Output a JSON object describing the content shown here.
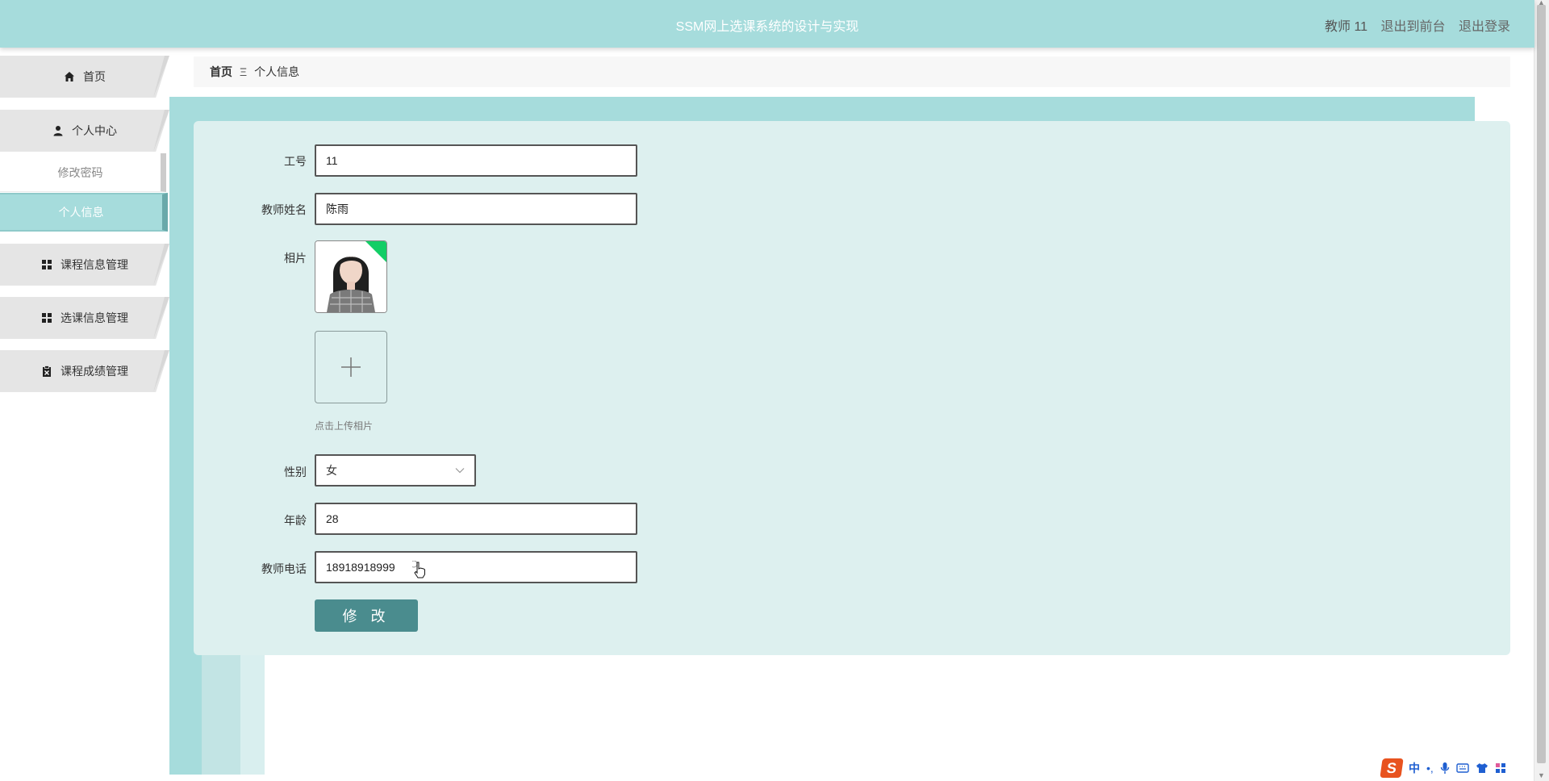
{
  "header": {
    "title": "SSM网上选课系统的设计与实现",
    "user": "教师 11",
    "back_front": "退出到前台",
    "logout": "退出登录"
  },
  "sidebar": {
    "home": "首页",
    "personal_center": "个人中心",
    "change_password": "修改密码",
    "personal_info": "个人信息",
    "course_mgmt": "课程信息管理",
    "selection_mgmt": "选课信息管理",
    "grade_mgmt": "课程成绩管理"
  },
  "breadcrumb": {
    "home": "首页",
    "separator": "Ξ",
    "current": "个人信息"
  },
  "form": {
    "id_label": "工号",
    "id_value": "11",
    "name_label": "教师姓名",
    "name_value": "陈雨",
    "photo_label": "相片",
    "upload_hint": "点击上传相片",
    "gender_label": "性别",
    "gender_value": "女",
    "age_label": "年龄",
    "age_value": "28",
    "phone_label": "教师电话",
    "phone_value": "18918918999",
    "submit_label": "修 改"
  },
  "ime": {
    "logo": "S",
    "mode": "中",
    "punct": "•,"
  },
  "colors": {
    "header_bg": "#a6dcdc",
    "form_bg": "#ddf0ef",
    "button_bg": "#4a8c8e",
    "upload_success": "#13ce66"
  }
}
